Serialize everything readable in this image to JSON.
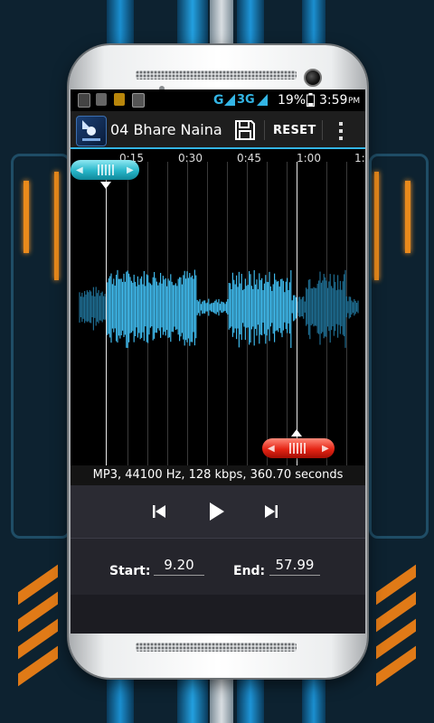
{
  "status_bar": {
    "network_label": "G",
    "data_label": "3G",
    "battery_percent": "19%",
    "clock": "3:59",
    "clock_suffix": "PM",
    "notification_icons": [
      "bbm-icon",
      "image-icon",
      "store-icon",
      "alert-icon"
    ]
  },
  "action_bar": {
    "title": "04 Bhare Naina",
    "reset_label": "RESET"
  },
  "timeline": {
    "ticks": [
      "0:15",
      "0:30",
      "0:45",
      "1:00",
      "1:"
    ]
  },
  "file_info": "MP3, 44100 Hz, 128 kbps, 360.70 seconds",
  "range": {
    "start_label": "Start:",
    "start_value": "9.20",
    "end_label": "End:",
    "end_value": "57.99"
  },
  "colors": {
    "accent": "#33b5e5",
    "wave_selected": "#3fb8ea",
    "wave_unselected": "#1e6b8f",
    "start_handle": "#27b6c9",
    "end_handle": "#e52414"
  }
}
